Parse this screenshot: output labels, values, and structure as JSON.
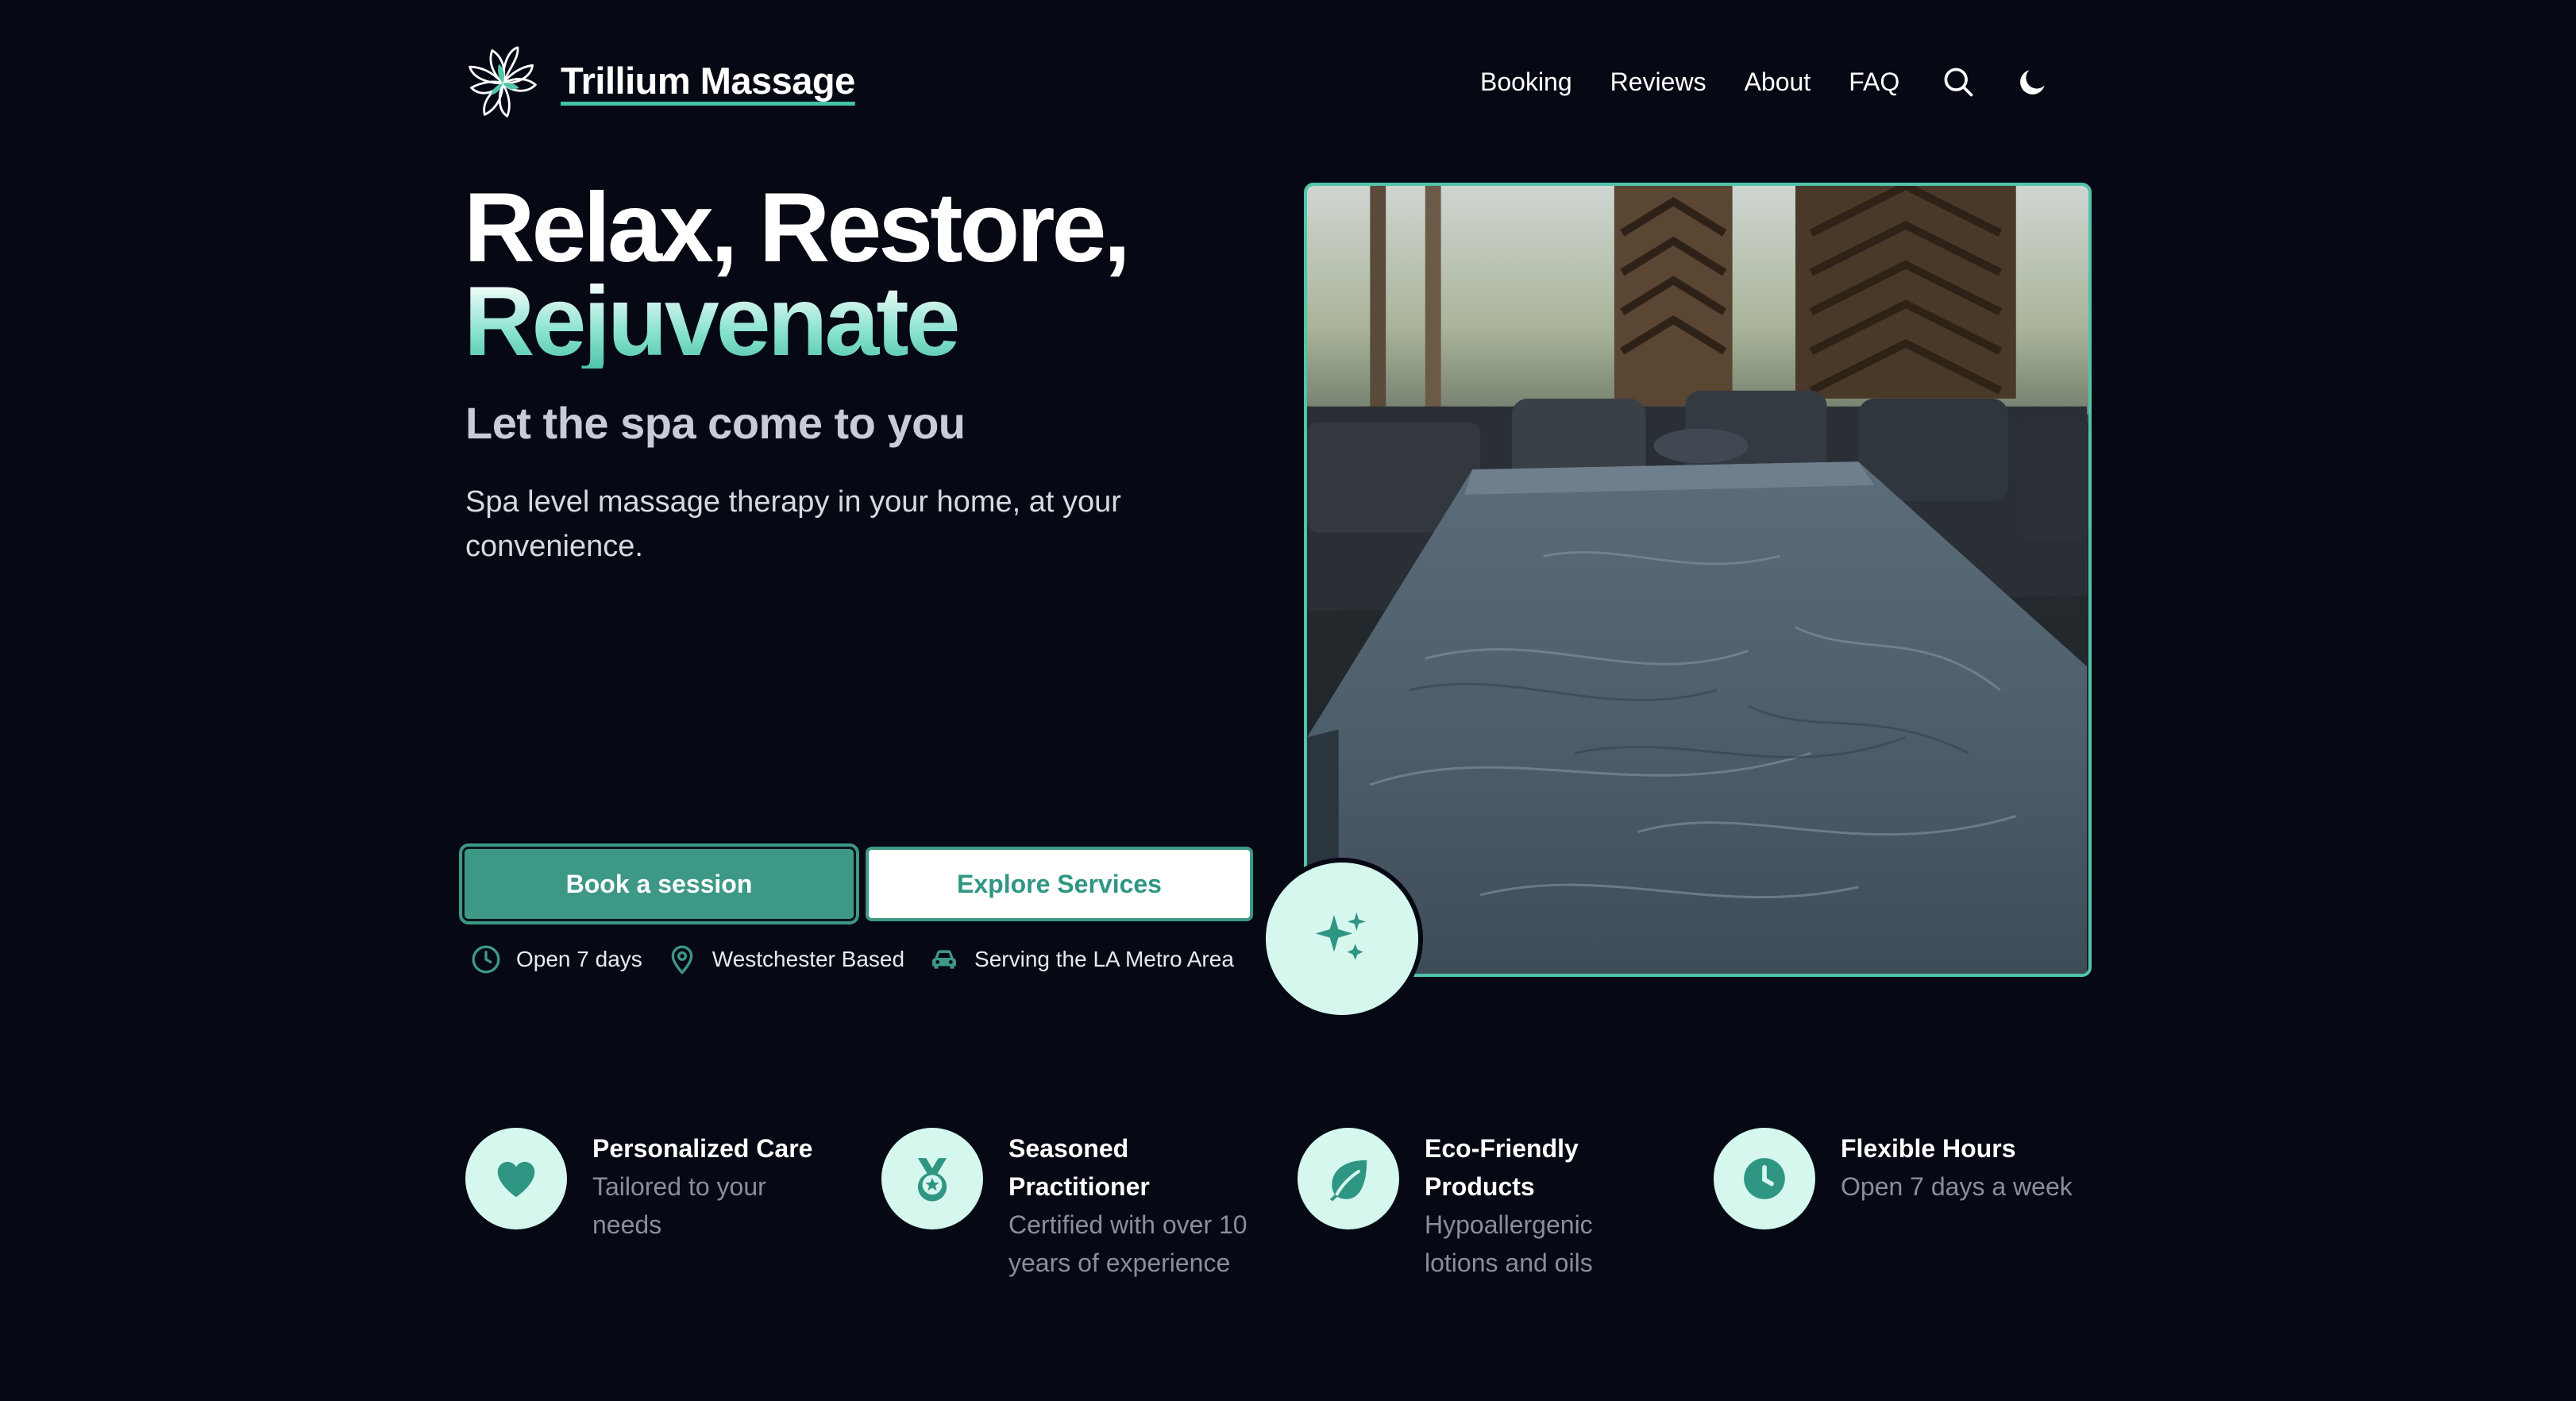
{
  "brand": {
    "name": "Trillium Massage",
    "logo_icon": "trillium-flower-logo"
  },
  "nav": {
    "items": [
      {
        "label": "Booking"
      },
      {
        "label": "Reviews"
      },
      {
        "label": "About"
      },
      {
        "label": "FAQ"
      }
    ],
    "search_icon": "search-icon",
    "theme_icon": "moon-icon"
  },
  "hero": {
    "title_line1": "Relax, Restore,",
    "title_line2": "Rejuvenate",
    "subtitle": "Let the spa come to you",
    "description": "Spa level massage therapy in your home, at your convenience.",
    "primary_button": "Book a session",
    "secondary_button": "Explore Services",
    "facts": [
      {
        "icon": "clock-icon",
        "label": "Open 7 days"
      },
      {
        "icon": "location-pin-icon",
        "label": "Westchester Based"
      },
      {
        "icon": "car-icon",
        "label": "Serving the LA Metro Area"
      }
    ],
    "image_subject": "massage table in a living room",
    "badge_icon": "sparkles-icon"
  },
  "features": [
    {
      "icon": "heart-icon",
      "title": "Personalized Care",
      "desc": "Tailored to your needs"
    },
    {
      "icon": "medal-icon",
      "title": "Seasoned Practitioner",
      "desc": "Certified with over 10 years of experience"
    },
    {
      "icon": "leaf-icon",
      "title": "Eco-Friendly Products",
      "desc": "Hypoallergenic lotions and oils"
    },
    {
      "icon": "clock-icon",
      "title": "Flexible Hours",
      "desc": "Open 7 days a week"
    }
  ],
  "colors": {
    "background": "#060913",
    "accent": "#3d9886",
    "accent_light": "#4fc5a9",
    "icon_circle": "#d6f7ee",
    "muted_text": "#8a8e99"
  }
}
